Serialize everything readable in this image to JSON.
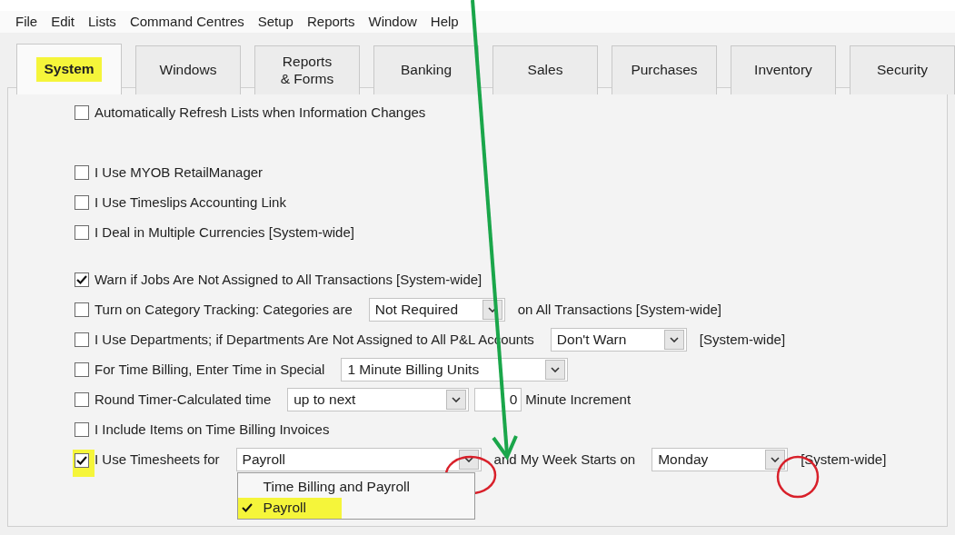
{
  "menu_bar": [
    "File",
    "Edit",
    "Lists",
    "Command Centres",
    "Setup",
    "Reports",
    "Window",
    "Help"
  ],
  "tabs": [
    {
      "label": "System",
      "selected": true,
      "highlighted": true
    },
    {
      "label": "Windows",
      "selected": false,
      "highlighted": false
    },
    {
      "label": "Reports\n& Forms",
      "selected": false,
      "highlighted": false
    },
    {
      "label": "Banking",
      "selected": false,
      "highlighted": false
    },
    {
      "label": "Sales",
      "selected": false,
      "highlighted": false
    },
    {
      "label": "Purchases",
      "selected": false,
      "highlighted": false
    },
    {
      "label": "Inventory",
      "selected": false,
      "highlighted": false
    },
    {
      "label": "Security",
      "selected": false,
      "highlighted": false
    }
  ],
  "groups": [
    {
      "rows": [
        {
          "checked": false,
          "highlighted": false,
          "parts": [
            {
              "kind": "text",
              "text": "Automatically Refresh Lists when Information Changes"
            }
          ]
        }
      ]
    },
    {
      "rows": [
        {
          "checked": false,
          "highlighted": false,
          "parts": [
            {
              "kind": "text",
              "text": "I Use MYOB RetailManager"
            }
          ]
        },
        {
          "checked": false,
          "highlighted": false,
          "parts": [
            {
              "kind": "text",
              "text": "I Use Timeslips Accounting Link"
            }
          ]
        },
        {
          "checked": false,
          "highlighted": false,
          "parts": [
            {
              "kind": "text",
              "text": "I Deal in Multiple Currencies [System-wide]"
            }
          ]
        }
      ]
    },
    {
      "rows": [
        {
          "checked": true,
          "highlighted": false,
          "parts": [
            {
              "kind": "text",
              "text": "Warn if Jobs Are Not Assigned to All Transactions [System-wide]"
            }
          ]
        },
        {
          "checked": false,
          "highlighted": false,
          "parts": [
            {
              "kind": "text",
              "text": "Turn on Category Tracking:  Categories are"
            },
            {
              "kind": "select",
              "value": "Not Required"
            },
            {
              "kind": "text",
              "text": "on All Transactions [System-wide]"
            }
          ]
        },
        {
          "checked": false,
          "highlighted": false,
          "parts": [
            {
              "kind": "text",
              "text": "I Use Departments; if Departments Are Not Assigned to All P&L Accounts"
            },
            {
              "kind": "select",
              "value": "Don't Warn"
            },
            {
              "kind": "text",
              "text": "[System-wide]"
            }
          ]
        },
        {
          "checked": false,
          "highlighted": false,
          "parts": [
            {
              "kind": "text",
              "text": "For Time Billing, Enter Time in Special"
            },
            {
              "kind": "select",
              "value": "1 Minute Billing Units"
            }
          ]
        },
        {
          "checked": false,
          "highlighted": false,
          "parts": [
            {
              "kind": "text",
              "text": "Round Timer-Calculated time"
            },
            {
              "kind": "select",
              "value": "up to next"
            },
            {
              "kind": "number",
              "value": "0"
            },
            {
              "kind": "text",
              "text": "Minute Increment"
            }
          ]
        },
        {
          "checked": false,
          "highlighted": false,
          "parts": [
            {
              "kind": "text",
              "text": "I Include Items on Time Billing Invoices"
            }
          ]
        },
        {
          "checked": true,
          "highlighted": true,
          "parts": [
            {
              "kind": "text",
              "text": "I Use Timesheets for"
            },
            {
              "kind": "select",
              "value": "Payroll",
              "expanded": true,
              "options": [
                {
                  "label": "Time Billing and Payroll",
                  "selected": false,
                  "highlighted": false
                },
                {
                  "label": "Payroll",
                  "selected": true,
                  "highlighted": true
                }
              ]
            },
            {
              "kind": "text",
              "text": "and My Week Starts on"
            },
            {
              "kind": "select",
              "value": "Monday"
            },
            {
              "kind": "text",
              "text": "[System-wide]"
            }
          ]
        }
      ]
    }
  ]
}
